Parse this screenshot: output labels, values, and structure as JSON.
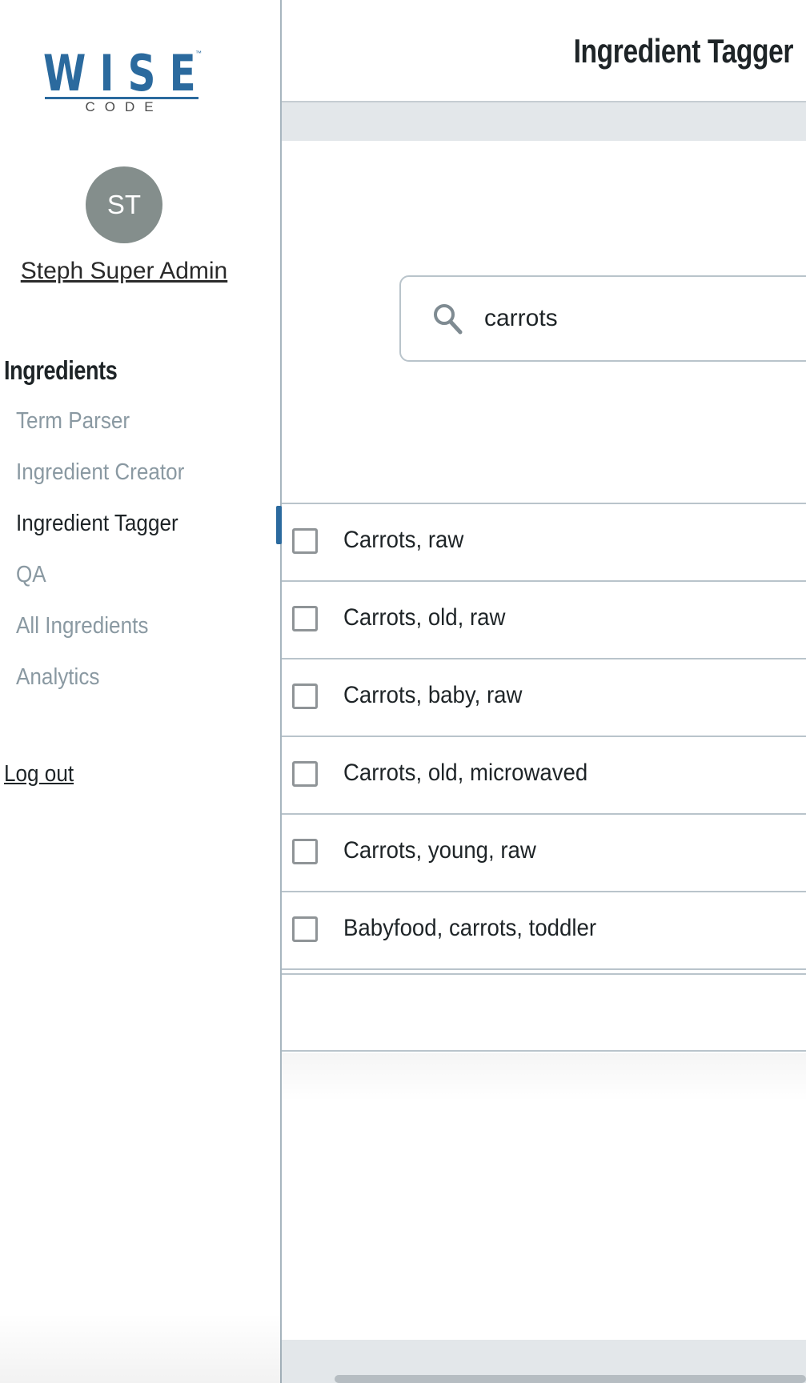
{
  "sidebar": {
    "logo": {
      "main": "WISE",
      "sub": "CODE",
      "tm": "™"
    },
    "avatar_initials": "ST",
    "user_name": "Steph Super Admin",
    "section_heading": "Ingredients",
    "items": [
      {
        "label": "Term Parser",
        "active": false
      },
      {
        "label": "Ingredient Creator",
        "active": false
      },
      {
        "label": "Ingredient Tagger",
        "active": true
      },
      {
        "label": "QA",
        "active": false
      },
      {
        "label": "All Ingredients",
        "active": false
      },
      {
        "label": "Analytics",
        "active": false
      }
    ],
    "logout_label": "Log out"
  },
  "main": {
    "title": "Ingredient Tagger",
    "search": {
      "value": "carrots",
      "icon": "search-icon"
    },
    "results": [
      {
        "label": "Carrots, raw",
        "checked": false
      },
      {
        "label": "Carrots, old, raw",
        "checked": false
      },
      {
        "label": "Carrots, baby, raw",
        "checked": false
      },
      {
        "label": "Carrots, old, microwaved",
        "checked": false
      },
      {
        "label": "Carrots, young, raw",
        "checked": false
      },
      {
        "label": "Babyfood, carrots, toddler",
        "checked": false
      }
    ]
  },
  "colors": {
    "brand": "#2b6a9e",
    "text": "#1e2427",
    "muted": "#8a99a2",
    "avatar": "#848e8c",
    "band": "#e3e7ea"
  }
}
